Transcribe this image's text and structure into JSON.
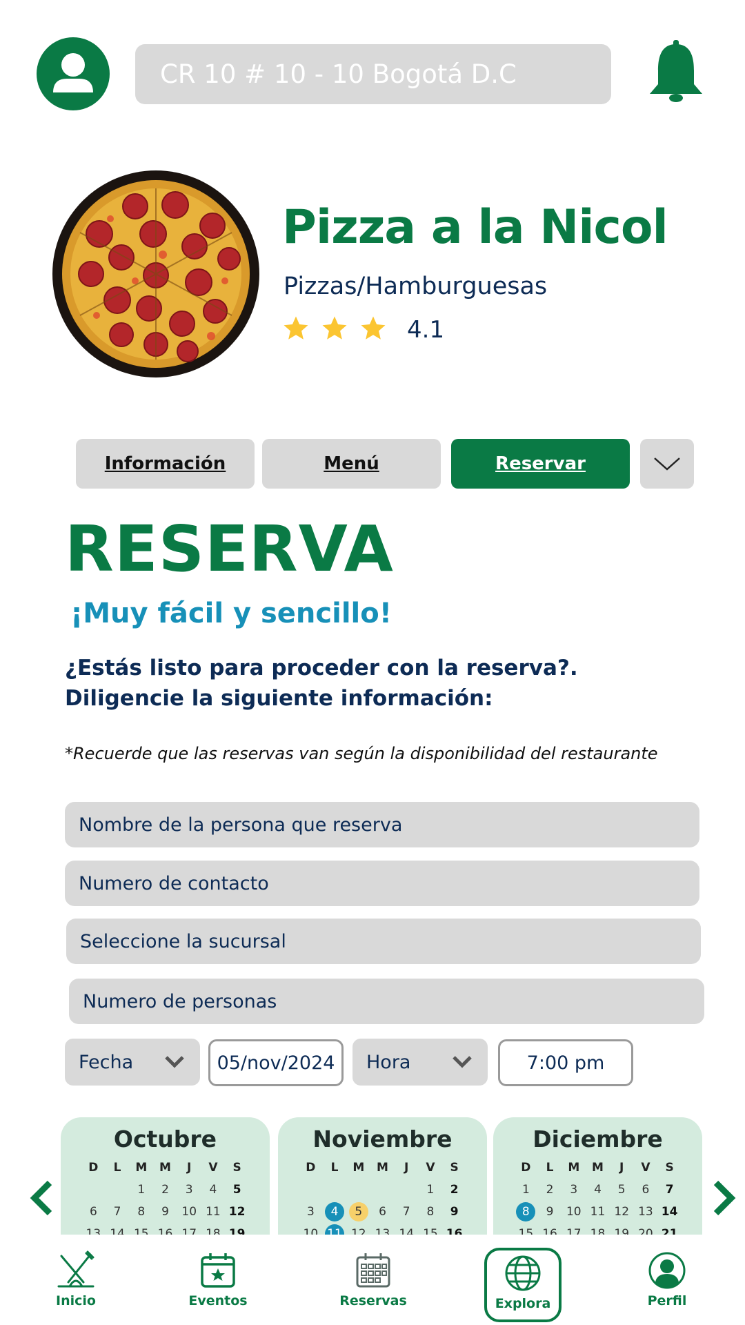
{
  "header": {
    "avatar_icon": "user-icon",
    "address": "CR 10 # 10 - 10 Bogotá D.C",
    "bell_icon": "bell-icon"
  },
  "restaurant": {
    "name": "Pizza a la Nicol",
    "category": "Pizzas/Hamburguesas",
    "rating": "4.1",
    "stars": 3
  },
  "tabs": {
    "info": "Información",
    "menu": "Menú",
    "reservar": "Reservar",
    "more_icon": "chevron-down-icon"
  },
  "reserva": {
    "title": "RESERVA",
    "subtitle": "¡Muy fácil y sencillo!",
    "question": "¿Estás listo para proceder con la reserva?. Diligencie la siguiente información:",
    "note": "*Recuerde que las reservas van según la disponibilidad del restaurante"
  },
  "form": {
    "name_placeholder": "Nombre de la persona que reserva",
    "contact_placeholder": "Numero de contacto",
    "branch_placeholder": "Seleccione la sucursal",
    "people_placeholder": "Numero de personas",
    "fecha_label": "Fecha",
    "fecha_value": "05/nov/2024",
    "hora_label": "Hora",
    "hora_value": "7:00 pm"
  },
  "calendar": {
    "weekdays": [
      "D",
      "L",
      "M",
      "M",
      "J",
      "V",
      "S"
    ],
    "months": [
      {
        "name": "Octubre",
        "offset": 2,
        "days": [
          "1",
          "2",
          "3",
          "4",
          "5",
          "6",
          "7",
          "8",
          "9",
          "10",
          "11",
          "12",
          "13",
          "14",
          "15",
          "16",
          "17",
          "18",
          "19"
        ],
        "highlight_blue": [],
        "highlight_yellow": []
      },
      {
        "name": "Noviembre",
        "offset": 5,
        "days": [
          "1",
          "2",
          "3",
          "4",
          "5",
          "6",
          "7",
          "8",
          "9",
          "10",
          "11",
          "12",
          "13",
          "14",
          "15",
          "16"
        ],
        "highlight_blue": [
          "4",
          "11"
        ],
        "highlight_yellow": [
          "5"
        ]
      },
      {
        "name": "Diciembre",
        "offset": 0,
        "days": [
          "1",
          "2",
          "3",
          "4",
          "5",
          "6",
          "7",
          "8",
          "9",
          "10",
          "11",
          "12",
          "13",
          "14",
          "15",
          "16",
          "17",
          "18",
          "19",
          "20",
          "21"
        ],
        "highlight_blue": [
          "8"
        ],
        "highlight_yellow": []
      }
    ],
    "colors": {
      "blue": "#1790b8",
      "yellow": "#f7d06a",
      "card": "#d4ebde"
    }
  },
  "nav": {
    "inicio": "Inicio",
    "eventos": "Eventos",
    "reservas": "Reservas",
    "explora": "Explora",
    "perfil": "Perfil"
  },
  "colors": {
    "brand_green": "#0a7a45",
    "navy": "#0d2b55",
    "field_gray": "#d9d9d9",
    "star": "#fbc531"
  }
}
